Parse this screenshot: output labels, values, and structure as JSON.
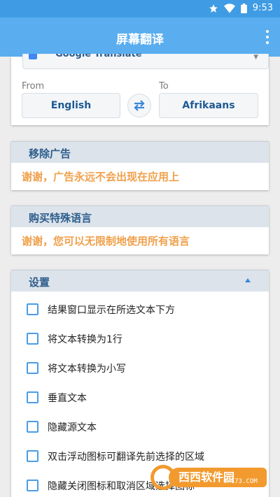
{
  "status_bar": {
    "time": "9:53",
    "icons": [
      "star-icon",
      "wifi-icon",
      "battery-icon"
    ]
  },
  "app_bar": {
    "title": "屏幕翻译",
    "menu_icon": "overflow-menu-icon"
  },
  "engine": {
    "name": "Google Translate",
    "dropdown_icon": "chevron-down-icon"
  },
  "languages": {
    "from_label": "From",
    "from_value": "English",
    "to_label": "To",
    "to_value": "Afrikaans",
    "swap_icon": "swap-icon"
  },
  "remove_ads": {
    "title": "移除广告",
    "message": "谢谢，广告永远不会出现在应用上"
  },
  "special_languages": {
    "title": "购买特殊语言",
    "message": "谢谢，您可以无限制地使用所有语言"
  },
  "settings": {
    "title": "设置",
    "collapse_icon": "triangle-up-icon",
    "options": [
      {
        "label": "结果窗口显示在所选文本下方",
        "checked": false
      },
      {
        "label": "将文本转换为1行",
        "checked": false
      },
      {
        "label": "将文本转换为小写",
        "checked": false
      },
      {
        "label": "垂直文本",
        "checked": false
      },
      {
        "label": "隐藏源文本",
        "checked": false
      },
      {
        "label": "双击浮动图标可翻译先前选择的区域",
        "checked": false
      },
      {
        "label": "隐藏关闭图标和取消区域选择图标",
        "checked": false
      }
    ]
  },
  "watermark": {
    "brand": "西西软件园",
    "url": "CR173.COM"
  },
  "colors": {
    "app_bar": "#5aaef0",
    "status_bar": "#3f9ce4",
    "accent": "#4a9de6",
    "message": "#f0a04b",
    "header_text": "#2d5e8c"
  }
}
